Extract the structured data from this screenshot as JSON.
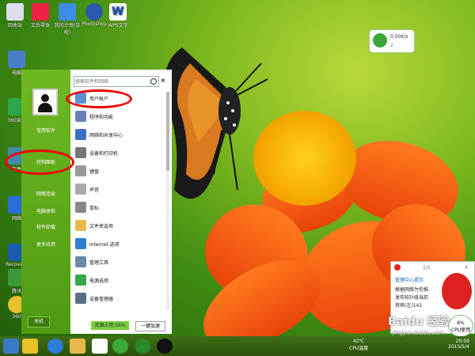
{
  "desktop": {
    "icons_top": [
      {
        "label": "回收站",
        "icon": "recycle-bin-icon"
      },
      {
        "label": "又后零食",
        "icon": "app-icon"
      },
      {
        "label": "我的计划(日程)",
        "icon": "calendar-app-icon"
      },
      {
        "label": "Photoshop",
        "icon": "photoshop-icon"
      },
      {
        "label": "WPS文字",
        "icon": "wps-writer-icon"
      }
    ],
    "icons_side": [
      {
        "label": "电脑",
        "icon": "computer-icon"
      },
      {
        "label": "360安全",
        "icon": "shield-icon"
      },
      {
        "label": "软件",
        "icon": "software-icon"
      },
      {
        "label": "网络",
        "icon": "network-icon"
      },
      {
        "label": "Recovery",
        "icon": "recovery-icon"
      },
      {
        "label": "腾讯",
        "icon": "tencent-icon"
      },
      {
        "label": "360",
        "icon": "security-icon"
      }
    ]
  },
  "start_menu": {
    "left_items": [
      "常用软件",
      "控制面板",
      "网络连接",
      "电脑体检",
      "软件卸载",
      "更多应用"
    ],
    "shutdown_label": "关机",
    "search_placeholder": "搜索软件和网络",
    "right_items": [
      {
        "label": "用户帐户",
        "icon": "user-accounts-icon",
        "color": "#5b8fd8"
      },
      {
        "label": "程序和功能",
        "icon": "programs-icon",
        "color": "#6a7fb8"
      },
      {
        "label": "网络和共享中心",
        "icon": "network-center-icon",
        "color": "#3a6fc4"
      },
      {
        "label": "设备和打印机",
        "icon": "printer-icon",
        "color": "#777777"
      },
      {
        "label": "键盘",
        "icon": "keyboard-icon",
        "color": "#999999"
      },
      {
        "label": "声音",
        "icon": "sound-icon",
        "color": "#aaaaaa"
      },
      {
        "label": "鼠标",
        "icon": "mouse-icon",
        "color": "#888888"
      },
      {
        "label": "文件夹选项",
        "icon": "folder-options-icon",
        "color": "#e8b84a"
      },
      {
        "label": "Internet 选项",
        "icon": "internet-options-icon",
        "color": "#2c7fd2"
      },
      {
        "label": "管理工具",
        "icon": "admin-tools-icon",
        "color": "#6a88a8"
      },
      {
        "label": "电源选项",
        "icon": "power-options-icon",
        "color": "#3aa64c"
      },
      {
        "label": "设备管理器",
        "icon": "device-manager-icon",
        "color": "#5a6e88"
      }
    ],
    "memory_label": "资源占用:56%",
    "speedup_label": "一键加速"
  },
  "widgets": {
    "net_speed": "0.00K/s",
    "net_count": "2",
    "popup_title": "管理中心提示",
    "popup_nav": "1/1",
    "popup_lines": [
      "根据网络为你推",
      "发布和升级当前",
      "爽爽(左)141"
    ],
    "cpu_percent": "6%",
    "cpu_label": "CPU使用"
  },
  "taskbar": {
    "temp_value": "42℃",
    "temp_label": "CPU温度",
    "time": "20:09",
    "date": "2015/5/4"
  },
  "watermark": {
    "text": "Baidu 经验",
    "sub": "jingyan.baidu.com"
  },
  "colors": {
    "accent_green": "#5aa51a",
    "highlight_red": "#e00000",
    "flower_orange": "#ff6a13"
  }
}
